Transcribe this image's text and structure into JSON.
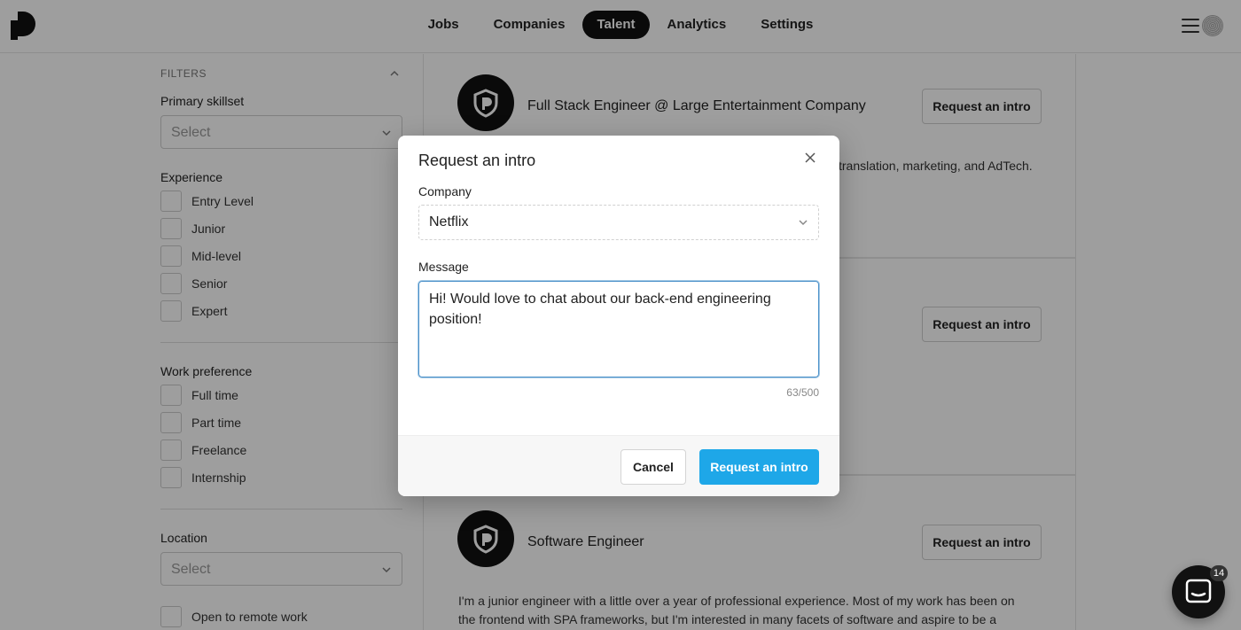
{
  "nav": {
    "items": [
      {
        "label": "Jobs",
        "active": false
      },
      {
        "label": "Companies",
        "active": false
      },
      {
        "label": "Talent",
        "active": true
      },
      {
        "label": "Analytics",
        "active": false
      },
      {
        "label": "Settings",
        "active": false
      }
    ]
  },
  "sidebar": {
    "filters_header": "FILTERS",
    "primary_skillset": {
      "label": "Primary skillset",
      "placeholder": "Select"
    },
    "experience": {
      "label": "Experience",
      "options": [
        "Entry Level",
        "Junior",
        "Mid-level",
        "Senior",
        "Expert"
      ]
    },
    "work_preference": {
      "label": "Work preference",
      "options": [
        "Full time",
        "Part time",
        "Freelance",
        "Internship"
      ]
    },
    "location": {
      "label": "Location",
      "placeholder": "Select"
    },
    "remote": {
      "label": "Open to remote work"
    }
  },
  "cards": [
    {
      "title": "Full Stack Engineer @ Large Entertainment Company",
      "button": "Request an intro",
      "snippet": "translation, marketing, and AdTech."
    },
    {
      "title": "",
      "button": "Request an intro",
      "snippet": ""
    },
    {
      "title": "Software Engineer",
      "button": "Request an intro",
      "snippet_line1": "I'm a junior engineer with a little over a year of professional experience. Most of my work has been on",
      "snippet_line2": "the frontend with SPA frameworks, but I'm interested in many facets of software and aspire to be a"
    }
  ],
  "modal": {
    "title": "Request an intro",
    "company_label": "Company",
    "company_value": "Netflix",
    "message_label": "Message",
    "message_value": "Hi! Would love to chat about our back-end engineering position!",
    "counter": "63/500",
    "cancel_label": "Cancel",
    "submit_label": "Request an intro"
  },
  "chat": {
    "badge": "14"
  },
  "colors": {
    "primary": "#1ea7e8",
    "nav_active": "#111111",
    "focus_border": "#4a90c9"
  }
}
